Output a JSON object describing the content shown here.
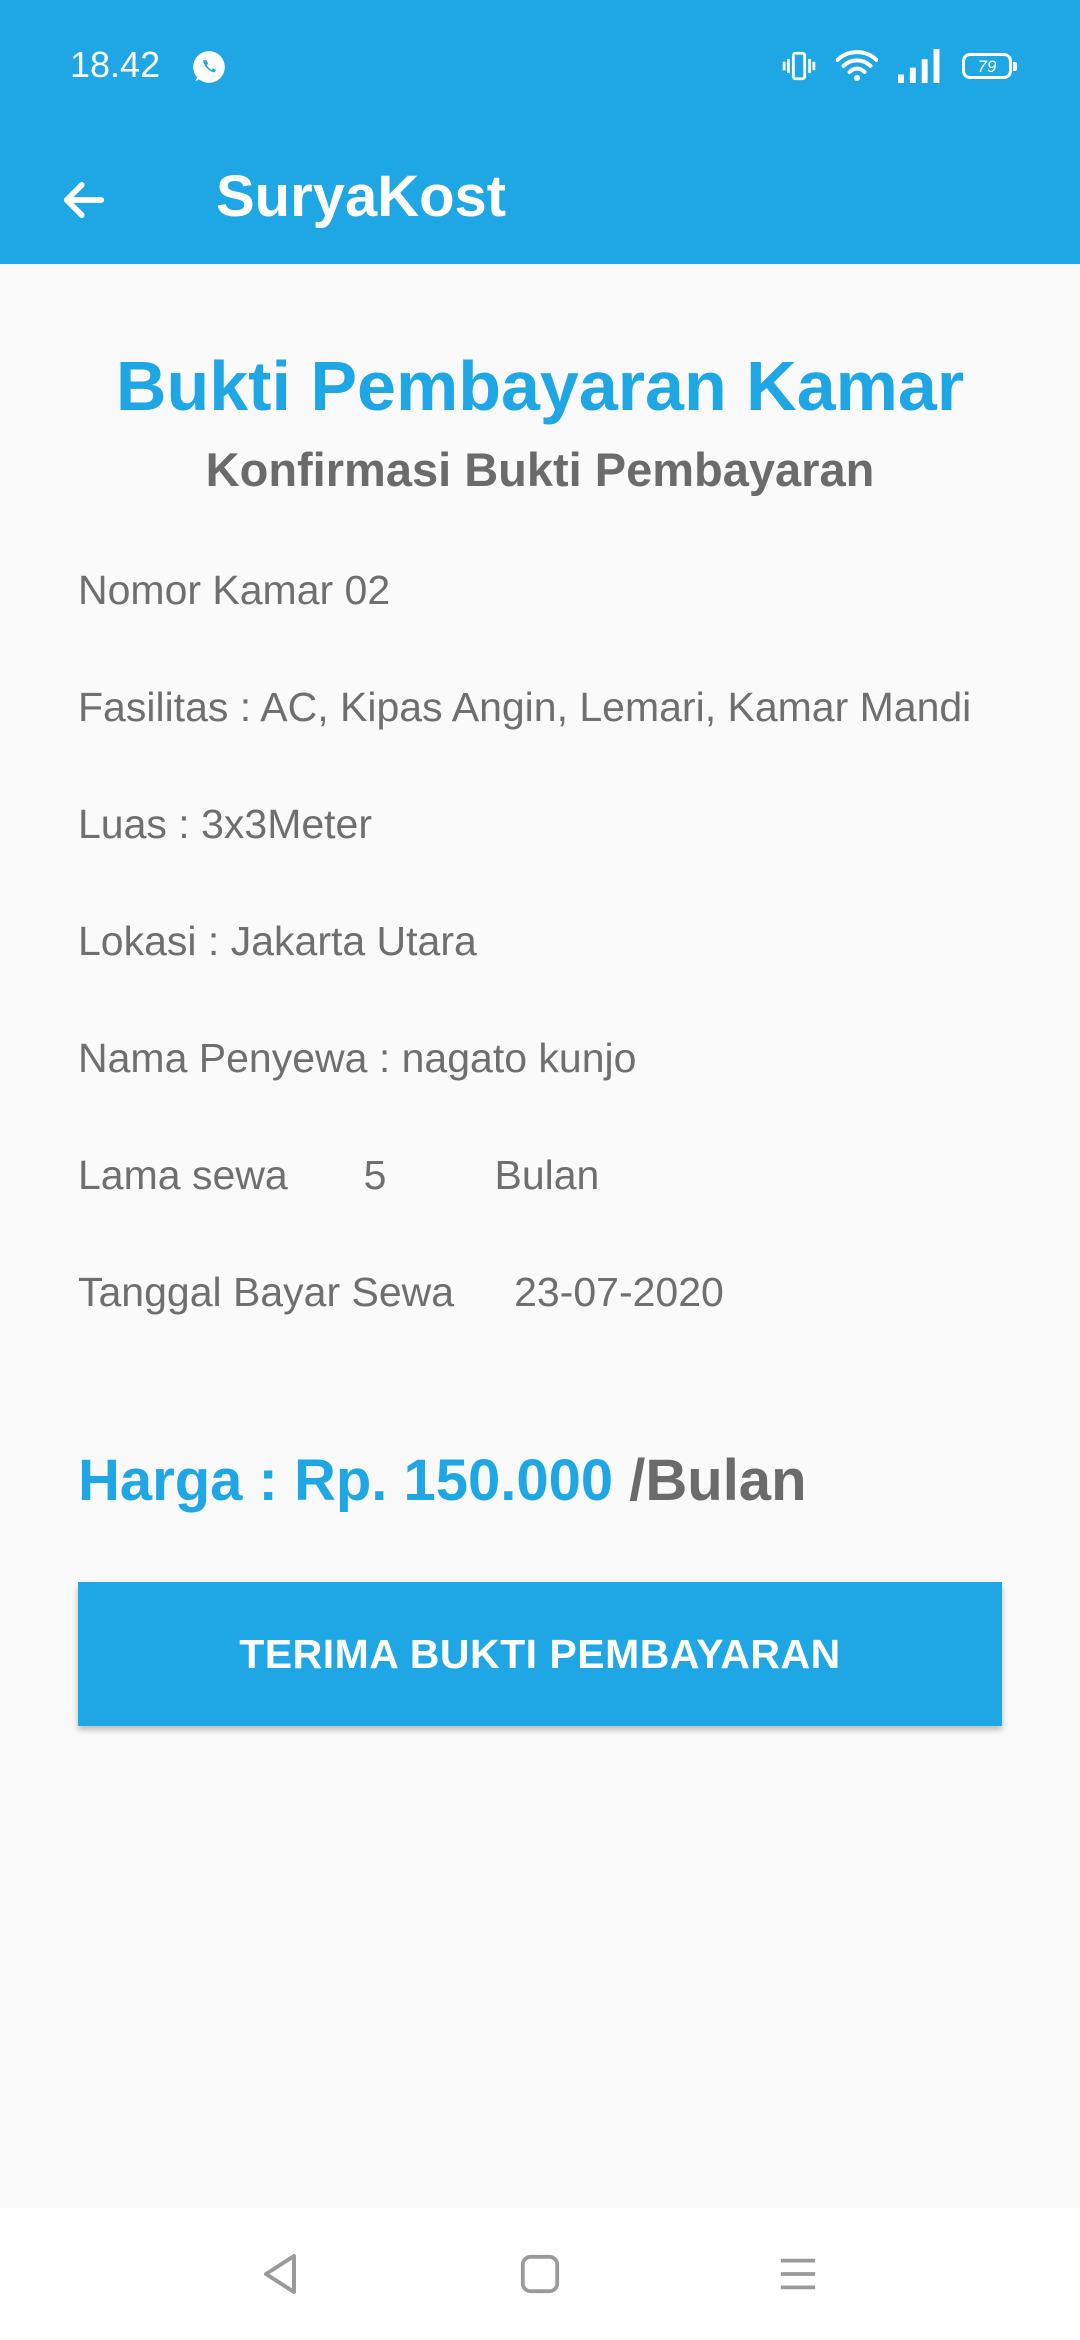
{
  "status_bar": {
    "time": "18.42",
    "battery": "79",
    "icons": [
      "whatsapp-icon",
      "vibrate-icon",
      "wifi-icon",
      "signal-icon",
      "battery-icon"
    ]
  },
  "app_bar": {
    "title": "SuryaKost",
    "back_icon": "arrow-left-icon"
  },
  "main": {
    "heading": "Bukti Pembayaran Kamar",
    "subheading": "Konfirmasi Bukti Pembayaran",
    "room_number": "Nomor Kamar 02",
    "facilities_label": "Fasilitas :",
    "facilities_value": "AC, Kipas Angin, Lemari, Kamar Mandi",
    "area_label": "Luas :",
    "area_value": "3x3Meter",
    "location_label": "Lokasi :",
    "location_value": "Jakarta Utara",
    "tenant_label": "Nama Penyewa :",
    "tenant_value": "nagato kunjo",
    "duration_label": "Lama sewa",
    "duration_value": "5",
    "duration_unit": "Bulan",
    "pay_date_label": "Tanggal Bayar Sewa",
    "pay_date_value": "23-07-2020",
    "price": "Harga : Rp. 150.000",
    "price_unit": "/Bulan",
    "confirm_button": "TERIMA BUKTI PEMBAYARAN"
  },
  "nav_bar": {
    "icons": [
      "back-triangle-icon",
      "home-square-icon",
      "menu-lines-icon"
    ]
  },
  "colors": {
    "primary": "#1fa7e5",
    "text_gray": "#6f6f6f",
    "background": "#fafafa"
  }
}
